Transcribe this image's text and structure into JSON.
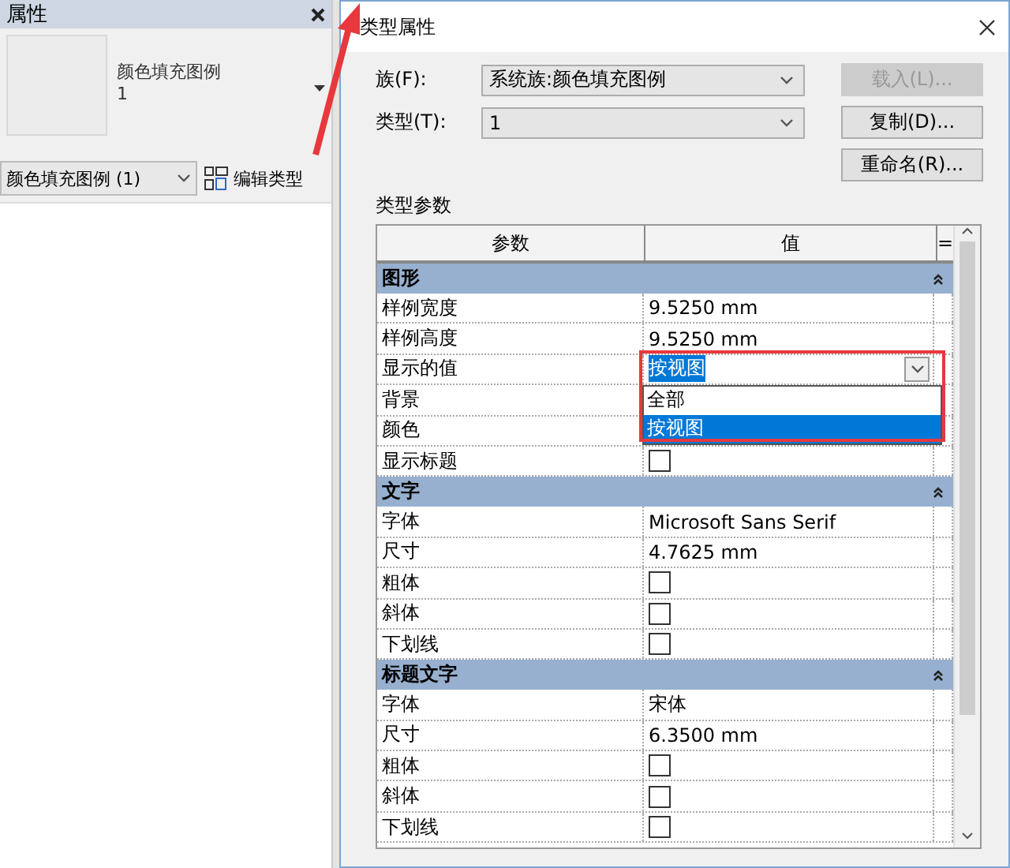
{
  "properties_panel": {
    "title": "属性",
    "preview": {
      "name": "颜色填充图例",
      "type": "1"
    },
    "type_selector": {
      "value": "颜色填充图例 (1)"
    },
    "edit_type_button": {
      "label": "编辑类型"
    }
  },
  "dialog": {
    "title": "类型属性",
    "fields": [
      {
        "label": "族(F):",
        "value": "系统族:颜色填充图例"
      },
      {
        "label": "类型(T):",
        "value": "1"
      }
    ],
    "buttons": [
      {
        "label": "载入(L)...",
        "disabled": true
      },
      {
        "label": "复制(D)...",
        "disabled": false
      },
      {
        "label": "重命名(R)...",
        "disabled": false
      }
    ],
    "section_label": "类型参数",
    "table": {
      "columns": [
        "参数",
        "值",
        "="
      ],
      "groups": [
        {
          "title": "图形",
          "rows": [
            {
              "name": "样例宽度",
              "kind": "text",
              "value": "9.5250 mm"
            },
            {
              "name": "样例高度",
              "kind": "text",
              "value": "9.5250 mm"
            },
            {
              "name": "显示的值",
              "kind": "dropdown",
              "value": "按视图",
              "highlighted": true,
              "options": [
                {
                  "label": "全部",
                  "selected": false
                },
                {
                  "label": "按视图",
                  "selected": true
                }
              ]
            },
            {
              "name": "背景",
              "kind": "blank"
            },
            {
              "name": "颜色",
              "kind": "blank"
            },
            {
              "name": "显示标题",
              "kind": "checkbox",
              "checked": false
            }
          ]
        },
        {
          "title": "文字",
          "rows": [
            {
              "name": "字体",
              "kind": "text",
              "value": "Microsoft Sans Serif"
            },
            {
              "name": "尺寸",
              "kind": "text",
              "value": "4.7625 mm"
            },
            {
              "name": "粗体",
              "kind": "checkbox",
              "checked": false
            },
            {
              "name": "斜体",
              "kind": "checkbox",
              "checked": false
            },
            {
              "name": "下划线",
              "kind": "checkbox",
              "checked": false
            }
          ]
        },
        {
          "title": "标题文字",
          "rows": [
            {
              "name": "字体",
              "kind": "text",
              "value": "宋体"
            },
            {
              "name": "尺寸",
              "kind": "text",
              "value": "6.3500 mm"
            },
            {
              "name": "粗体",
              "kind": "checkbox",
              "checked": false
            },
            {
              "name": "斜体",
              "kind": "checkbox",
              "checked": false
            },
            {
              "name": "下划线",
              "kind": "checkbox",
              "checked": false
            }
          ]
        }
      ]
    }
  }
}
